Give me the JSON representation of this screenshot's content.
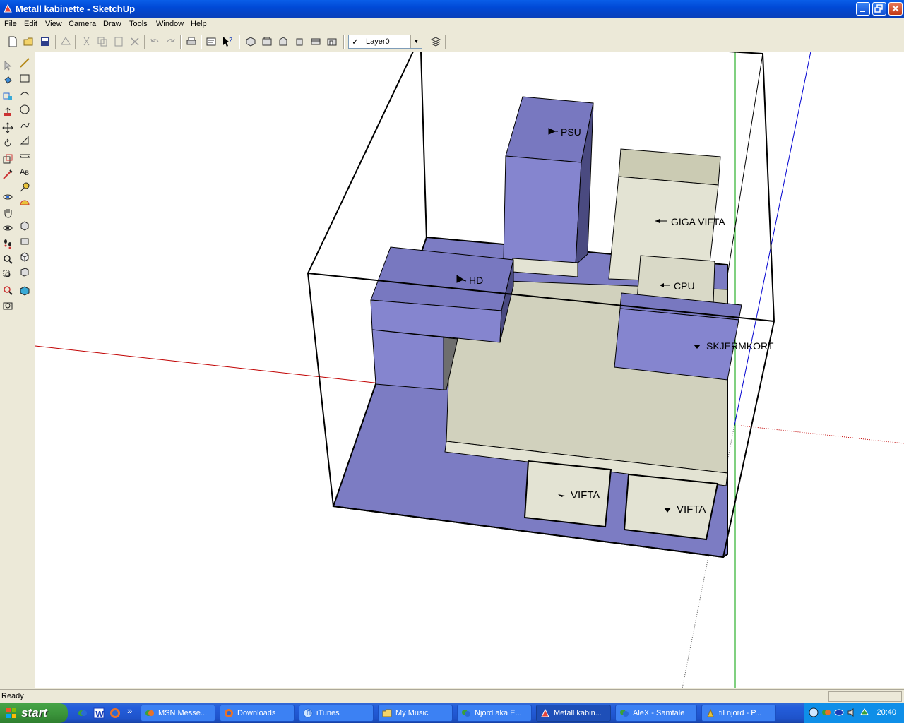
{
  "window": {
    "title": "Metall kabinette - SketchUp"
  },
  "menu": [
    "File",
    "Edit",
    "View",
    "Camera",
    "Draw",
    "Tools",
    "Window",
    "Help"
  ],
  "toolbar": {
    "layer_value": "Layer0",
    "layer_checked": "✓"
  },
  "scene": {
    "labels": {
      "psu": "PSU",
      "giga_vifta": "GIGA VIFTA",
      "cpu": "CPU",
      "hd": "HD",
      "skjermkort": "SKJERMKORT",
      "vifta_1": "VIFTA",
      "vifta_2": "VIFTA"
    },
    "colors": {
      "blue_face": "#8585cf",
      "beige_face": "#d1d1bd",
      "axis_red": "#c00000",
      "axis_green": "#00a000",
      "axis_blue": "#0000d0"
    }
  },
  "status": {
    "text": "Ready"
  },
  "taskbar": {
    "start": "start",
    "overflow": "»",
    "tasks": [
      "MSN Messe...",
      "Downloads",
      "iTunes",
      "My Music",
      "Njord aka E...",
      "Metall kabin...",
      "AleX - Samtale",
      "til njord - P..."
    ],
    "clock": "20:40"
  }
}
